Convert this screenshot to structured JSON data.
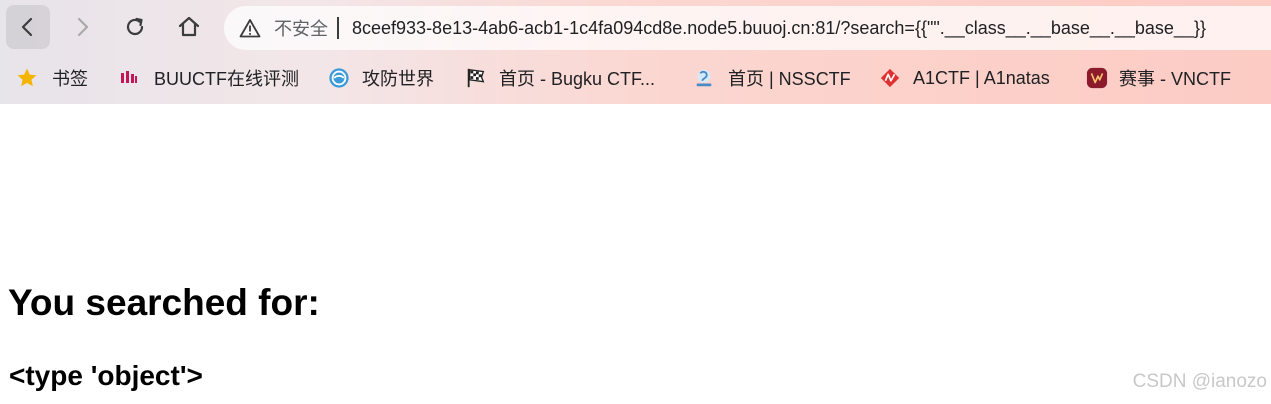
{
  "browser": {
    "address_bar": {
      "security_label": "不安全",
      "url": "8ceef933-8e13-4ab6-acb1-1c4fa094cd8e.node5.buuoj.cn:81/?search={{\"\".__class__.__base__.__base__}}"
    },
    "bookmarks": [
      {
        "label": "书签",
        "icon": "star-icon"
      },
      {
        "label": "BUUCTF在线评测",
        "icon": "buuctf-icon"
      },
      {
        "label": "攻防世界",
        "icon": "globe-icon"
      },
      {
        "label": "首页 - Bugku CTF...",
        "icon": "checkered-flag-icon"
      },
      {
        "label": "首页 | NSSCTF",
        "icon": "nssctf-icon"
      },
      {
        "label": "A1CTF | A1natas",
        "icon": "a1ctf-icon"
      },
      {
        "label": "赛事 - VNCTF",
        "icon": "vnctf-icon"
      }
    ]
  },
  "page": {
    "heading": "You searched for:",
    "result": "<type 'object'>"
  },
  "watermark": "CSDN @ianozo",
  "colors": {
    "star": "#f5b400",
    "a1ctf": "#e03131",
    "vnctf": "#8b1a2b"
  }
}
